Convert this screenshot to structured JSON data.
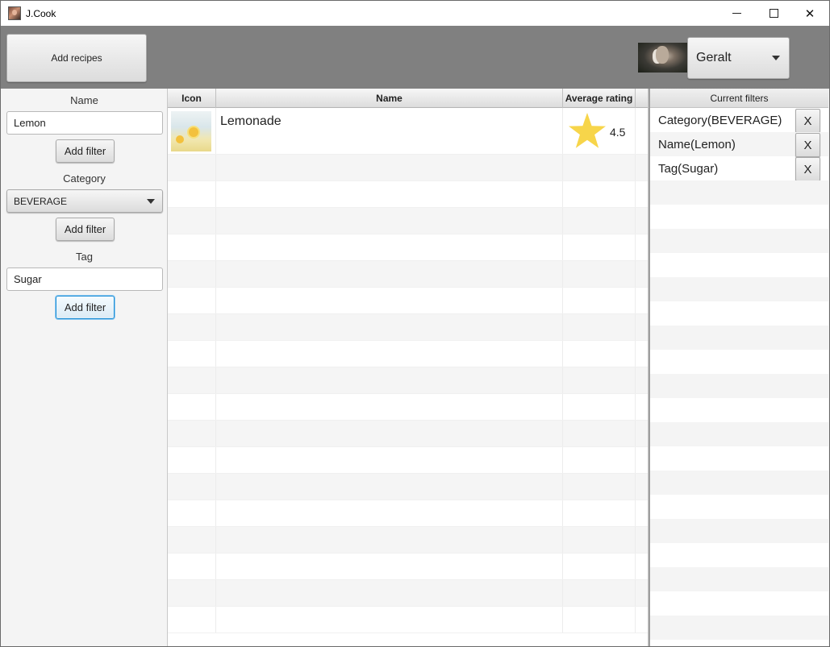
{
  "window": {
    "title": "J.Cook"
  },
  "toolbar": {
    "add_recipes_label": "Add recipes",
    "user_name": "Geralt"
  },
  "filters": {
    "name_label": "Name",
    "name_value": "Lemon",
    "category_label": "Category",
    "category_value": "BEVERAGE",
    "tag_label": "Tag",
    "tag_value": "Sugar",
    "add_filter_label": "Add filter"
  },
  "table": {
    "columns": [
      "Icon",
      "Name",
      "Average rating"
    ],
    "recipes": [
      {
        "name": "Lemonade",
        "rating": "4.5",
        "icon": "lemonade-image"
      }
    ],
    "empty_rows": 18
  },
  "current_filters": {
    "header": "Current filters",
    "remove_label": "X",
    "items": [
      "Category(BEVERAGE)",
      "Name(Lemon)",
      "Tag(Sugar)"
    ]
  },
  "colors": {
    "toolbar_bg": "#808080",
    "star": "#f7d54a",
    "focus": "#1e8fd6"
  }
}
